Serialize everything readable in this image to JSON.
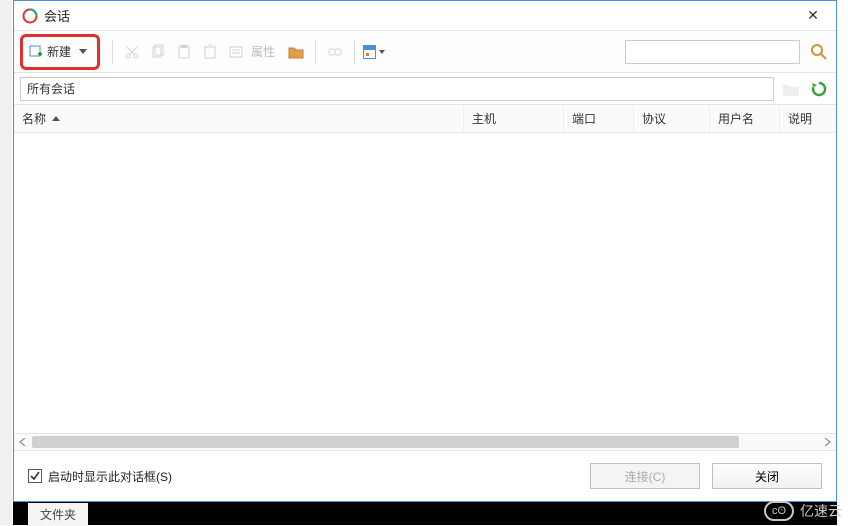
{
  "title": "会话",
  "toolbar": {
    "new_label": "新建",
    "props_label": "属性"
  },
  "pathbar": {
    "path_text": "所有会话"
  },
  "columns": [
    "名称",
    "主机",
    "端口",
    "协议",
    "用户名",
    "说明"
  ],
  "footer": {
    "show_on_start_label": "启动时显示此对话框(S)",
    "connect_label": "连接(C)",
    "close_label": "关闭"
  },
  "below": {
    "tab_label": "文件夹"
  },
  "watermark": {
    "text": "亿速云"
  }
}
